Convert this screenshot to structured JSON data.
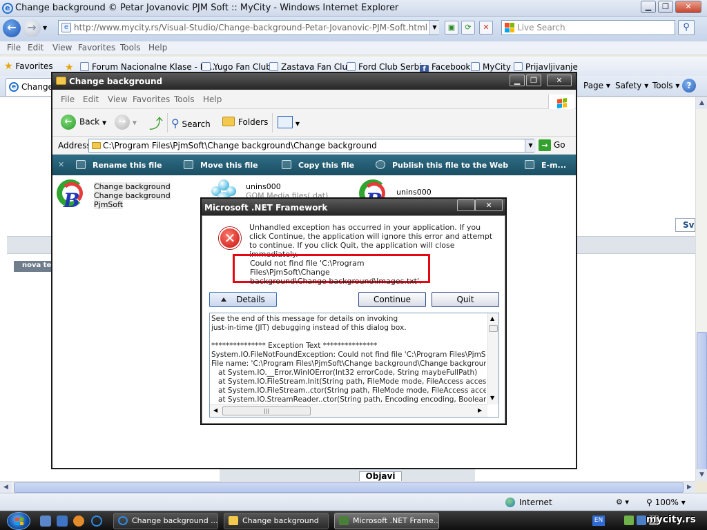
{
  "ie": {
    "title": "Change background © Petar Jovanovic PJM Soft :: MyCity - Windows Internet Explorer",
    "address": "http://www.mycity.rs/Visual-Studio/Change-background-Petar-Jovanovic-PJM-Soft.html",
    "search_placeholder": "Live Search",
    "menu": [
      "File",
      "Edit",
      "View",
      "Favorites",
      "Tools",
      "Help"
    ],
    "favorites_label": "Favorites",
    "favorites_links": [
      "Forum Nacionalne Klase - Po...",
      "Yugo Fan Club",
      "Zastava Fan Club",
      "Ford Club Serbia",
      "Facebook",
      "MyCity",
      "Prijavljivanje"
    ],
    "tab_label": "Change b",
    "commands": [
      "Page ▾",
      "Safety ▾",
      "Tools ▾"
    ],
    "status_zone": "Internet",
    "zoom": "100%"
  },
  "page_bg": {
    "nova_label": "nova tem",
    "sv_label": "Sv",
    "objavi_label": "Objavi"
  },
  "explorer": {
    "title": "Change background",
    "menu": [
      "File",
      "Edit",
      "View",
      "Favorites",
      "Tools",
      "Help"
    ],
    "back_label": "Back",
    "search_label": "Search",
    "folders_label": "Folders",
    "address_label": "Address",
    "address_value": "C:\\Program Files\\PjmSoft\\Change background\\Change background",
    "go_label": "Go",
    "tasks": [
      "Rename this file",
      "Move this file",
      "Copy this file",
      "Publish this file to the Web",
      "E-m..."
    ],
    "files": [
      {
        "line1": "Change background",
        "line2": "Change background",
        "line3": "PjmSoft"
      },
      {
        "line1": "unins000",
        "line2": "GOM Media files(.dat)"
      },
      {
        "line1": "unins000"
      }
    ]
  },
  "dialog": {
    "title": "Microsoft .NET Framework",
    "message": "Unhandled exception has occurred in your application. If you click Continue, the application will ignore this error and attempt to continue. If you click Quit, the application will close immediately.",
    "error_line1": "Could not find file 'C:\\Program Files\\PjmSoft\\Change",
    "error_line2": "background\\Change background\\Images.txt'.",
    "details_label": "Details",
    "continue_label": "Continue",
    "quit_label": "Quit",
    "details_text": "See the end of this message for details on invoking\njust-in-time (JIT) debugging instead of this dialog box.\n\n*************** Exception Text ***************\nSystem.IO.FileNotFoundException: Could not find file 'C:\\Program Files\\PjmSoft\\Char\nFile name: 'C:\\Program Files\\PjmSoft\\Change background\\Change background\\Ima\n   at System.IO.__Error.WinIOError(Int32 errorCode, String maybeFullPath)\n   at System.IO.FileStream.Init(String path, FileMode mode, FileAccess access, Int32 r\n   at System.IO.FileStream..ctor(String path, FileMode mode, FileAccess access, FileS\n   at System.IO.StreamReader..ctor(String path, Encoding encoding, Boolean detectE"
  },
  "taskbar": {
    "tasks": [
      "Change background ...",
      "Change background",
      "Microsoft .NET Frame..."
    ],
    "language": "EN",
    "watermark": "mycity.rs"
  }
}
